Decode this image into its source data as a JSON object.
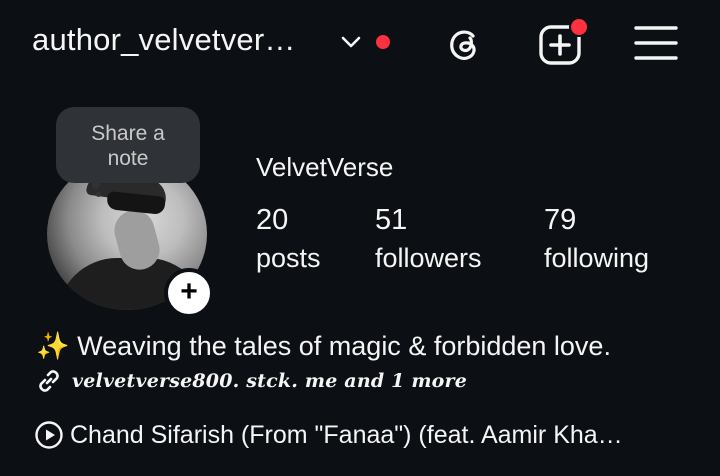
{
  "header": {
    "username": "author_velvetver…",
    "chevron_icon": "chevron-down-icon",
    "threads_icon": "threads-icon",
    "create_icon": "plus-square-icon",
    "menu_icon": "hamburger-menu-icon",
    "notification_color": "#ff3040"
  },
  "profile": {
    "note_prompt": [
      "Share a",
      "note"
    ],
    "display_name": "VelvetVerse",
    "add_story_glyph": "+",
    "stats": [
      {
        "value": "20",
        "label": "posts"
      },
      {
        "value": "51",
        "label": "followers"
      },
      {
        "value": "79",
        "label": "following"
      }
    ]
  },
  "bio": {
    "emoji": "✨",
    "text": "Weaving the tales of magic & forbidden love.",
    "link_icon": "link-icon",
    "link_text": "velvetverse800. stck. me and 1 more",
    "music_icon": "play-circle-icon",
    "music_text": "Chand Sifarish (From \"Fanaa\") (feat. Aamir Kha…"
  },
  "colors": {
    "background": "#0c1014",
    "text": "#f5f5f5",
    "note_bubble": "#2f3338"
  }
}
